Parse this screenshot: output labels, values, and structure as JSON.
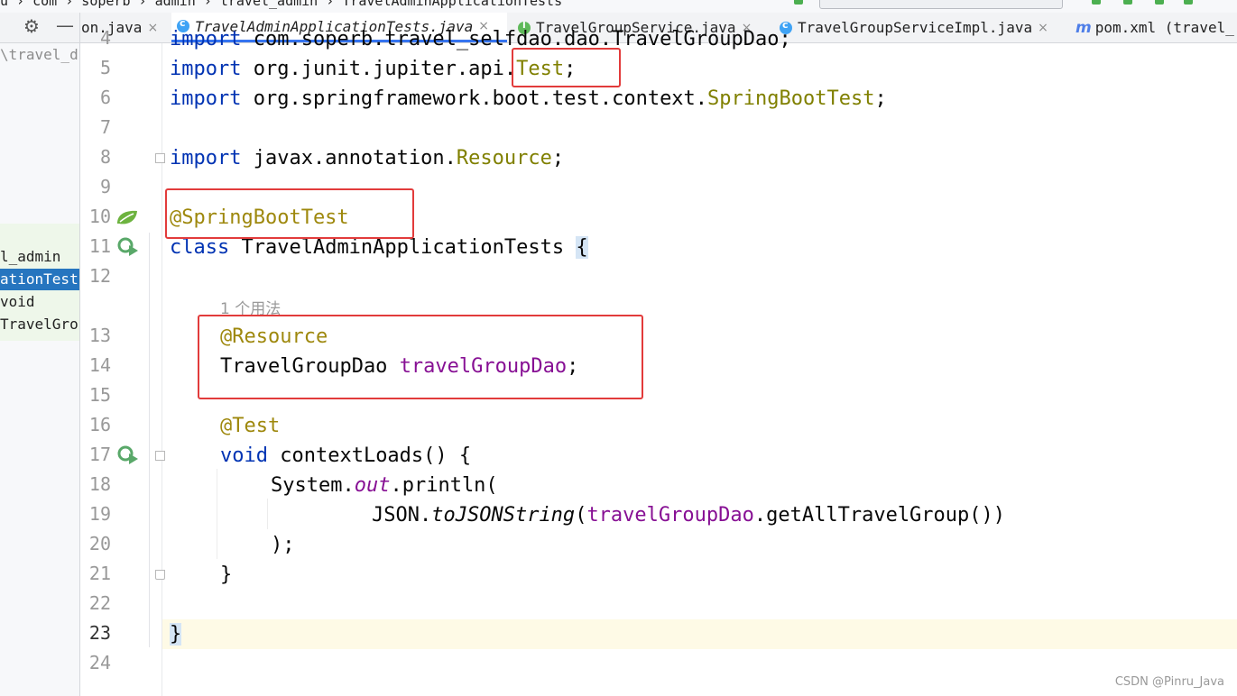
{
  "breadcrumb": "u › com › soperb › admin › travel_admin › TravelAdminApplicationTests",
  "tabs": [
    {
      "label": "on.java",
      "icon": "class-icon",
      "active": false
    },
    {
      "label": "TravelAdminApplicationTests.java",
      "icon": "class-icon",
      "active": true
    },
    {
      "label": "TravelGroupService.java",
      "icon": "interface-icon",
      "active": false
    },
    {
      "label": "TravelGroupServiceImpl.java",
      "icon": "class-icon",
      "active": false
    },
    {
      "label": "pom.xml (travel_",
      "icon": "maven-icon",
      "active": false
    }
  ],
  "tab_close": "×",
  "project_panel": {
    "path": "\\travel_d",
    "items": [
      "l_admin",
      "ationTest",
      "void",
      "TravelGro"
    ]
  },
  "line_numbers": [
    "4",
    "5",
    "6",
    "7",
    "8",
    "9",
    "10",
    "11",
    "12",
    "13",
    "14",
    "15",
    "16",
    "17",
    "18",
    "19",
    "20",
    "21",
    "22",
    "23",
    "24"
  ],
  "code": {
    "l4": [
      "import",
      " com.soperb.travel_selfdao.dao.TravelGroupDao;"
    ],
    "l5": [
      "import",
      " org.junit.jupiter.api.",
      "Test",
      ";"
    ],
    "l6": [
      "import",
      " org.springframework.boot.test.context.",
      "SpringBootTest",
      ";"
    ],
    "l8": [
      "import",
      " javax.annotation.",
      "Resource",
      ";"
    ],
    "l10": [
      "@SpringBootTest"
    ],
    "l11": [
      "class",
      " TravelAdminApplicationTests ",
      "{"
    ],
    "usage_hint": "1 个用法",
    "l13": [
      "@Resource"
    ],
    "l14": [
      "TravelGroupDao ",
      "travelGroupDao",
      ";"
    ],
    "l16": [
      "@Test"
    ],
    "l17": [
      "void",
      " contextLoads() {"
    ],
    "l18": [
      "System.",
      "out",
      ".println("
    ],
    "l19": [
      "JSON.",
      "toJSONString",
      "(",
      "travelGroupDao",
      ".getAllTravelGroup())"
    ],
    "l20": [
      ");"
    ],
    "l21": [
      "}"
    ],
    "l23": [
      "}"
    ]
  },
  "watermark": "CSDN @Pinru_Java",
  "colors": {
    "keyword": "#0033b3",
    "annotation": "#9e880d",
    "class_ref": "#808000",
    "field": "#871094",
    "highlight_box": "#e23b3b",
    "active_tab_underline": "#3574f0"
  }
}
